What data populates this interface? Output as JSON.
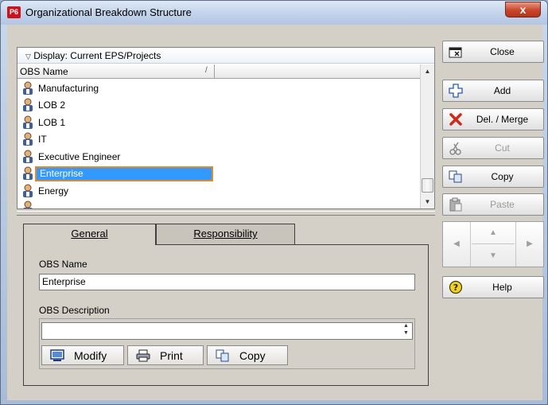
{
  "window": {
    "title": "Organizational Breakdown Structure",
    "app_badge": "P6",
    "close_glyph": "x"
  },
  "list": {
    "display_label": "Display: Current EPS/Projects",
    "column_header": "OBS Name",
    "sort_glyph": "/",
    "items": [
      {
        "label": "Manufacturing"
      },
      {
        "label": "LOB 2"
      },
      {
        "label": "LOB 1"
      },
      {
        "label": "IT"
      },
      {
        "label": "Executive Engineer"
      },
      {
        "label": "Enterprise",
        "selected": true
      },
      {
        "label": "Energy"
      }
    ]
  },
  "tabs": [
    {
      "label": "General",
      "active": true
    },
    {
      "label": "Responsibility",
      "active": false
    }
  ],
  "general": {
    "obs_name_label": "OBS Name",
    "obs_name_value": "Enterprise",
    "obs_desc_label": "OBS Description",
    "obs_desc_value": "",
    "buttons": {
      "modify": "Modify",
      "print": "Print",
      "copy": "Copy"
    }
  },
  "side_buttons": {
    "close": "Close",
    "add": "Add",
    "delmerge": "Del. / Merge",
    "cut": "Cut",
    "copy": "Copy",
    "paste": "Paste",
    "help": "Help"
  },
  "colors": {
    "selection": "#3399ff",
    "selection_border": "#e08a2c",
    "badge": "#c8141e"
  }
}
